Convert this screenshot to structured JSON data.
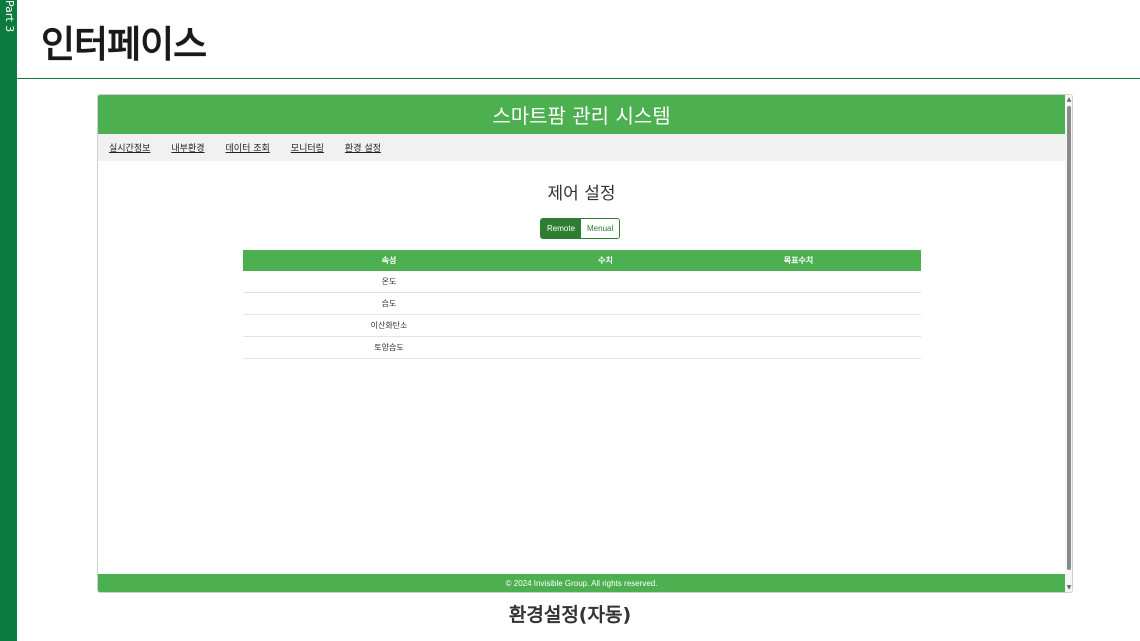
{
  "slide": {
    "part_label": "Part 3",
    "title": "인터페이스",
    "caption": "환경설정(자동)"
  },
  "app": {
    "header_title": "스마트팜 관리 시스템",
    "nav": [
      {
        "label": "실시간정보"
      },
      {
        "label": "내부환경"
      },
      {
        "label": "데이터 조회"
      },
      {
        "label": "모니터링"
      },
      {
        "label": "환경 설정"
      }
    ],
    "section_title": "제어 설정",
    "mode_toggle": {
      "options": [
        "Remote",
        "Menual"
      ],
      "selected": "Remote"
    },
    "table": {
      "headers": [
        "속성",
        "수치",
        "목표수치"
      ],
      "rows": [
        [
          "온도",
          "",
          ""
        ],
        [
          "습도",
          "",
          ""
        ],
        [
          "이산화탄소",
          "",
          ""
        ],
        [
          "토양습도",
          "",
          ""
        ]
      ]
    },
    "footer": "© 2024 Invisible Group. All rights reserved."
  },
  "colors": {
    "brand_green": "#4caf50",
    "dark_green": "#2e7d32",
    "slide_accent": "#0d7a3e"
  }
}
